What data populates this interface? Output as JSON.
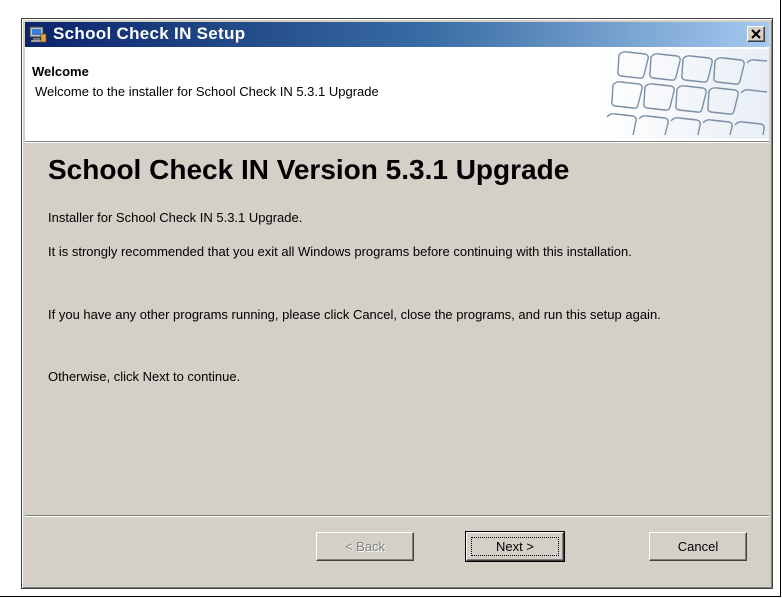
{
  "window": {
    "title": "School Check IN Setup"
  },
  "header": {
    "title": "Welcome",
    "subtitle": "Welcome to the installer for School Check IN  5.3.1 Upgrade"
  },
  "main": {
    "heading": "School Check IN Version 5.3.1 Upgrade",
    "paragraphs": [
      "Installer for School Check IN  5.3.1 Upgrade.",
      "It is strongly recommended that you exit all Windows programs before continuing with this installation.",
      "If you have any other programs running, please click Cancel, close the programs, and run this setup again.",
      "Otherwise, click Next to continue."
    ]
  },
  "buttons": {
    "back_label": "< Back",
    "next_label": "Next >",
    "cancel_label": "Cancel",
    "back_enabled": false
  },
  "icons": {
    "app": "installer-computer-icon",
    "close": "close-icon",
    "header_graphic": "keyboard-keys-graphic"
  },
  "colors": {
    "titlebar_start": "#0a246a",
    "titlebar_end": "#a6caf0",
    "dialog_face": "#d4d0c8"
  }
}
